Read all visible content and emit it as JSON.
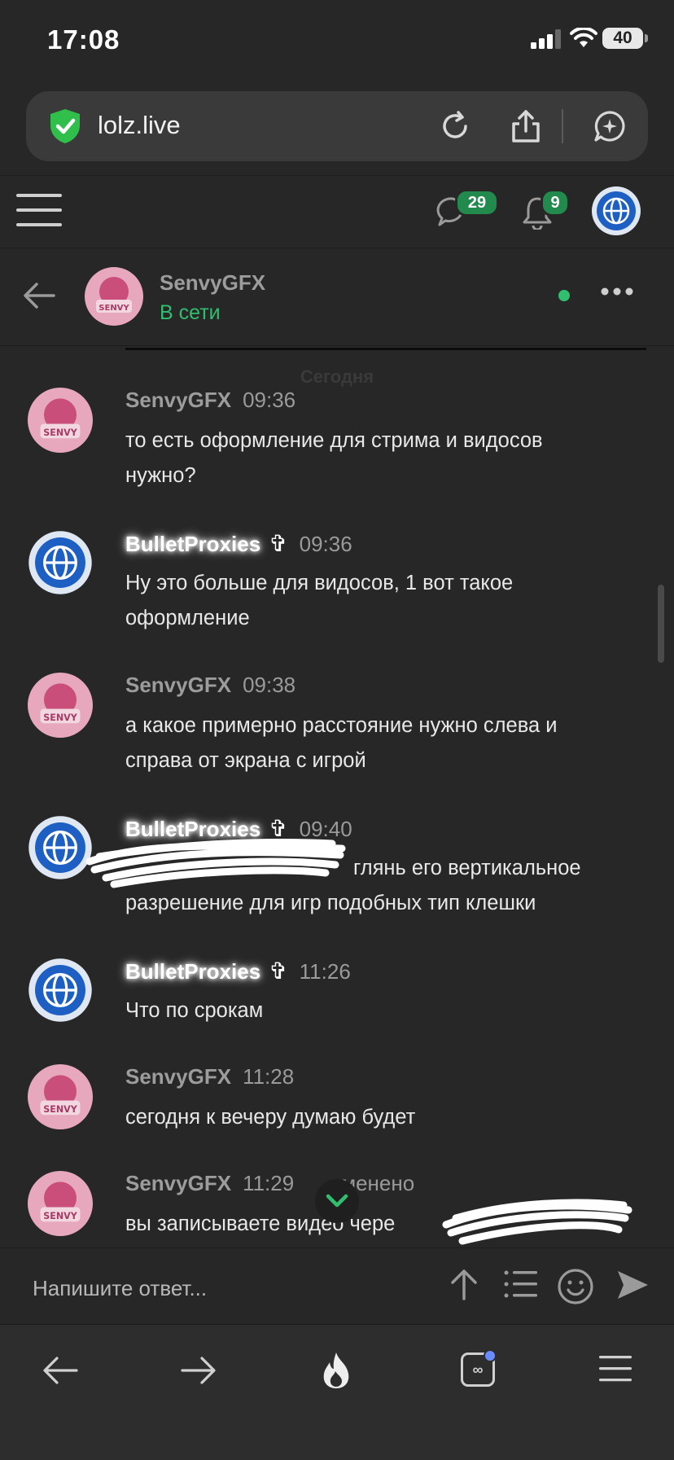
{
  "status_bar": {
    "time": "17:08",
    "battery": "40"
  },
  "browser": {
    "url": "lolz.live"
  },
  "forum_header": {
    "messages_badge": "29",
    "alerts_badge": "9"
  },
  "chat": {
    "name": "SenvyGFX",
    "status": "В сети",
    "day_label": "Сегодня"
  },
  "messages": [
    {
      "author": "SenvyGFX",
      "time": "09:36",
      "line1": "то есть оформление для стрима и видосов",
      "line2": "нужно?"
    },
    {
      "author": "BulletProxies",
      "cross": "✞",
      "time": "09:36",
      "line1": "Ну это больше для видосов, 1 вот такое",
      "line2": "оформление"
    },
    {
      "author": "SenvyGFX",
      "time": "09:38",
      "line1": "а какое примерно расстояние нужно слева и",
      "line2": "справа от экрана с игрой"
    },
    {
      "author": "BulletProxies",
      "cross": "✞",
      "time": "09:40",
      "line1": " глянь его вертикальное",
      "line2": "разрешение для игр подобных тип клешки"
    },
    {
      "author": "BulletProxies",
      "cross": "✞",
      "time": "11:26",
      "line1": "Что по срокам"
    },
    {
      "author": "SenvyGFX",
      "time": "11:28",
      "line1": "сегодня к вечеру думаю будет"
    },
    {
      "author": "SenvyGFX",
      "time": "11:29",
      "edited": "менено",
      "line1": "вы записываете видео чере"
    }
  ],
  "reply": {
    "placeholder": "Напишите ответ..."
  },
  "icons": {
    "colors": {
      "accent_green": "#2fbf6e",
      "badge_green": "#238a4d",
      "background": "#272727"
    }
  }
}
